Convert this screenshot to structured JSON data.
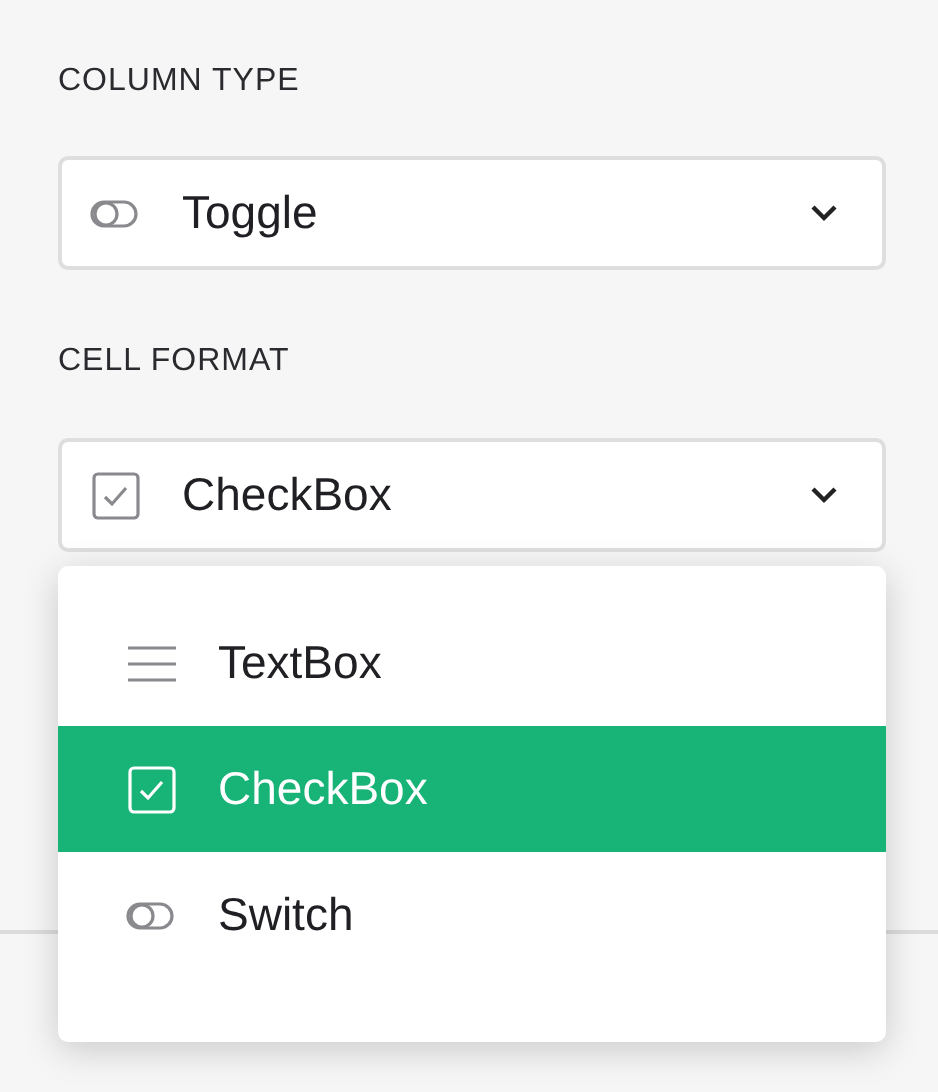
{
  "column_type": {
    "label": "COLUMN TYPE",
    "value": "Toggle",
    "kind": "toggle"
  },
  "cell_format": {
    "label": "CELL FORMAT",
    "value": "CheckBox",
    "kind": "checkbox",
    "expanded": true,
    "options": [
      {
        "label": "TextBox",
        "kind": "lines",
        "selected": false
      },
      {
        "label": "CheckBox",
        "kind": "checkbox",
        "selected": true
      },
      {
        "label": "Switch",
        "kind": "toggle",
        "selected": false
      }
    ]
  }
}
